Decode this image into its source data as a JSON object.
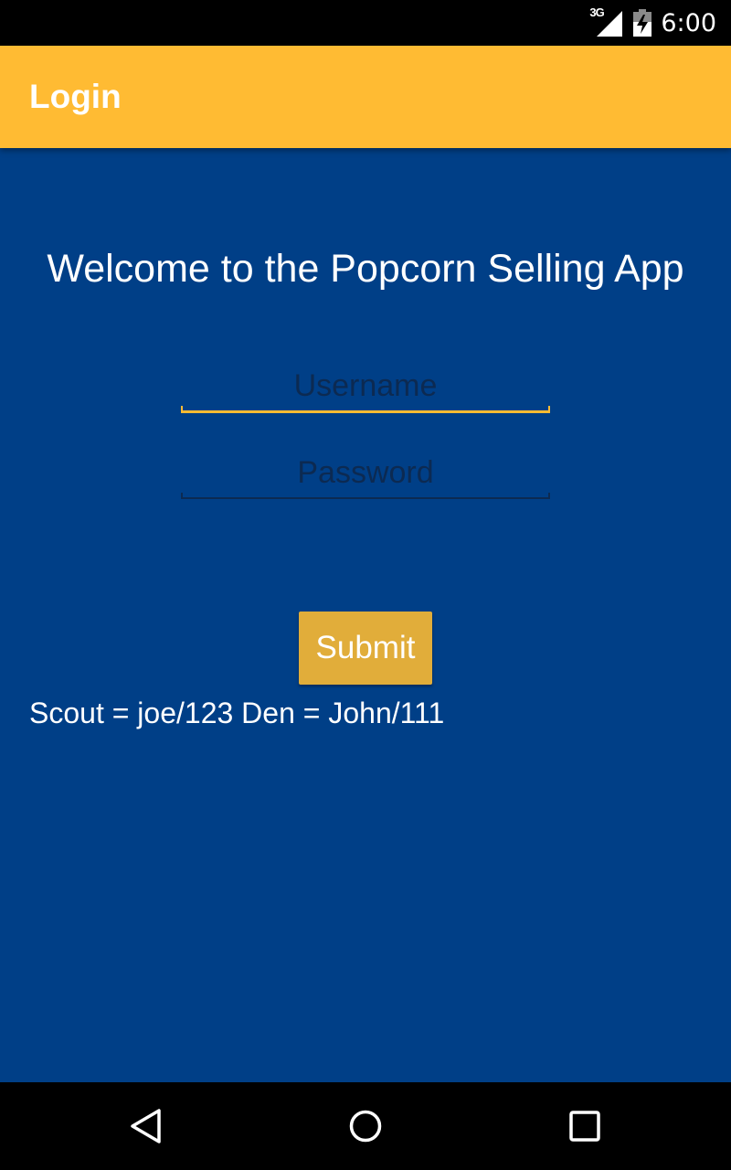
{
  "status_bar": {
    "network_type": "3G",
    "time": "6:00",
    "icons": [
      "signal-icon",
      "battery-charging-icon"
    ]
  },
  "app_bar": {
    "title": "Login",
    "color": "#ffbb33"
  },
  "content": {
    "background_color": "#003f87",
    "welcome_text": "Welcome to the Popcorn Selling App",
    "username": {
      "value": "",
      "placeholder": "Username"
    },
    "password": {
      "value": "",
      "placeholder": "Password"
    },
    "submit_label": "Submit",
    "submit_color": "#e1ad3a",
    "hint_text": "Scout = joe/123 Den = John/111"
  },
  "nav_bar": {
    "buttons": [
      "back-icon",
      "home-icon",
      "recents-icon"
    ]
  }
}
